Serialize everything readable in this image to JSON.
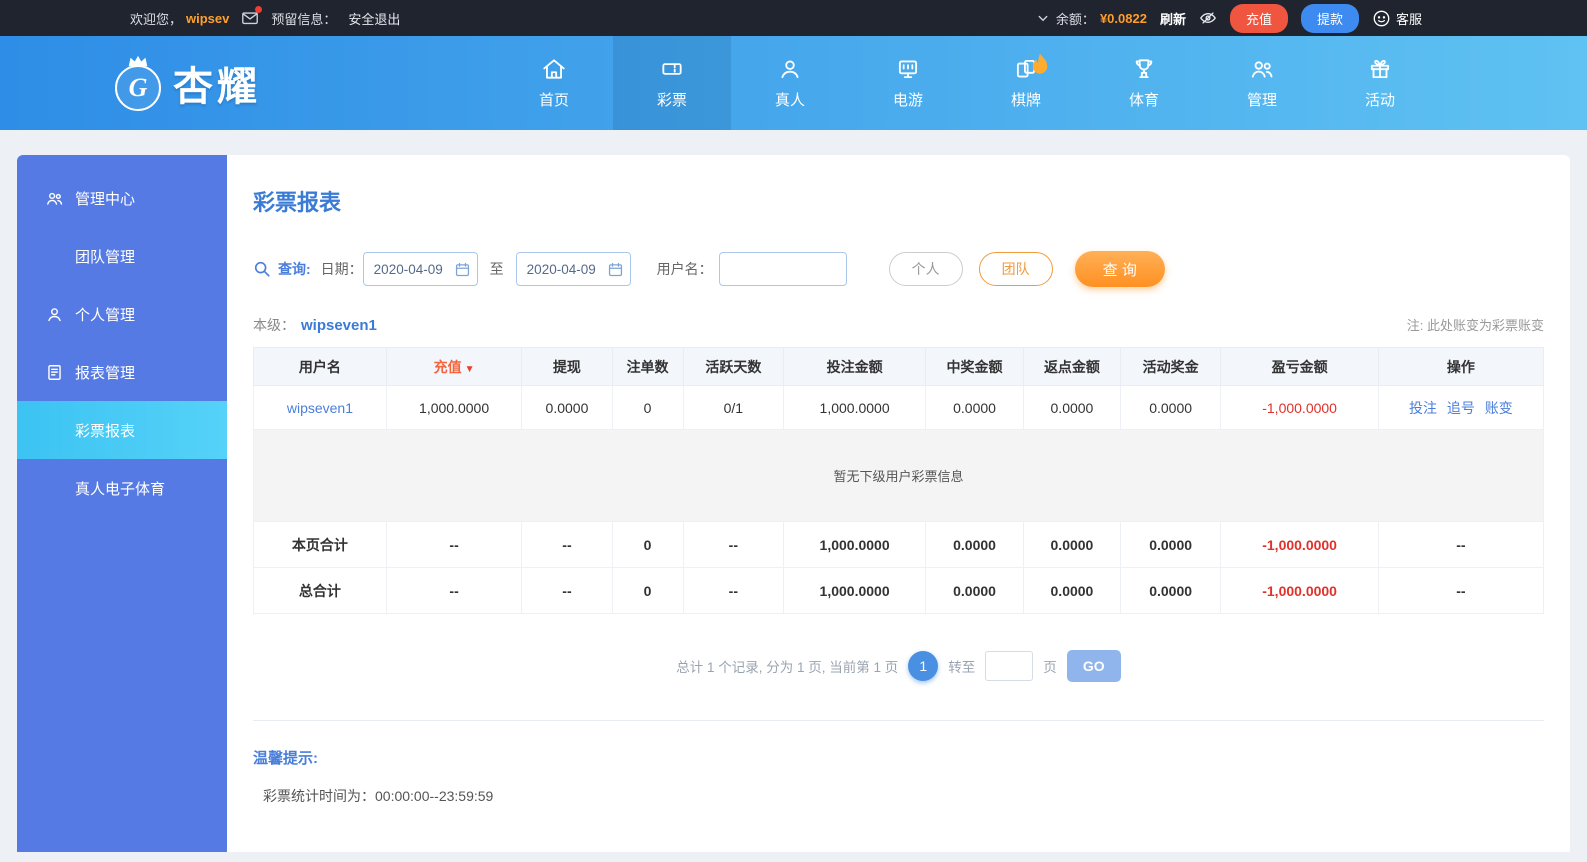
{
  "topbar": {
    "welcome_prefix": "欢迎您，",
    "username": "wipsev",
    "reserved_label": "预留信息：",
    "logout_label": "安全退出",
    "balance_label": "余额：",
    "balance_value": "¥0.0822",
    "refresh_label": "刷新",
    "recharge_label": "充值",
    "withdraw_label": "提款",
    "service_label": "客服"
  },
  "nav": {
    "brand": "杏耀",
    "items": [
      {
        "label": "首页"
      },
      {
        "label": "彩票"
      },
      {
        "label": "真人"
      },
      {
        "label": "电游"
      },
      {
        "label": "棋牌"
      },
      {
        "label": "体育"
      },
      {
        "label": "管理"
      },
      {
        "label": "活动"
      }
    ]
  },
  "sidebar": {
    "items": [
      {
        "label": "管理中心"
      },
      {
        "label": "团队管理"
      },
      {
        "label": "个人管理"
      },
      {
        "label": "报表管理"
      },
      {
        "label": "彩票报表"
      },
      {
        "label": "真人电子体育"
      }
    ]
  },
  "main": {
    "title": "彩票报表",
    "search": {
      "query_label": "查询:",
      "date_label": "日期：",
      "date_from": "2020-04-09",
      "to_label": "至",
      "date_to": "2020-04-09",
      "username_label": "用户名：",
      "personal_button": "个人",
      "team_button": "团队",
      "search_button": "查 询"
    },
    "level_label": "本级：",
    "level_user": "wipseven1",
    "note": "注: 此处账变为彩票账变",
    "table": {
      "headers": [
        "用户名",
        "充值",
        "提现",
        "注单数",
        "活跃天数",
        "投注金额",
        "中奖金额",
        "返点金额",
        "活动奖金",
        "盈亏金额",
        "操作"
      ],
      "sort_arrow": "▼",
      "rows": [
        {
          "username": "wipseven1",
          "recharge": "1,000.0000",
          "withdraw": "0.0000",
          "bet_count": "0",
          "active_days": "0/1",
          "bet_amount": "1,000.0000",
          "win_amount": "0.0000",
          "rebate_amount": "0.0000",
          "activity_bonus": "0.0000",
          "profit_loss": "-1,000.0000",
          "actions": [
            "投注",
            "追号",
            "账变"
          ]
        }
      ],
      "empty_message": "暂无下级用户彩票信息",
      "page_total": {
        "label": "本页合计",
        "recharge": "--",
        "withdraw": "--",
        "bet_count": "0",
        "active_days": "--",
        "bet_amount": "1,000.0000",
        "win_amount": "0.0000",
        "rebate_amount": "0.0000",
        "activity_bonus": "0.0000",
        "profit_loss": "-1,000.0000",
        "actions": "--"
      },
      "grand_total": {
        "label": "总合计",
        "recharge": "--",
        "withdraw": "--",
        "bet_count": "0",
        "active_days": "--",
        "bet_amount": "1,000.0000",
        "win_amount": "0.0000",
        "rebate_amount": "0.0000",
        "activity_bonus": "0.0000",
        "profit_loss": "-1,000.0000",
        "actions": "--"
      }
    },
    "pagination": {
      "summary": "总计 1 个记录, 分为 1 页, 当前第 1 页",
      "current_page": "1",
      "goto_label": "转至",
      "page_unit": "页",
      "go_button": "GO"
    },
    "tips": {
      "title": "温馨提示:",
      "content": "彩票统计时间为：00:00:00--23:59:59"
    }
  },
  "icons": {
    "envelope-icon": "✉",
    "caret-down-icon": "∨",
    "eye-slash-icon": "visibility-toggle",
    "service-icon": "smiley-bubble",
    "search-icon": "magnifier",
    "calendar-icon": "calendar",
    "flame-icon": "hot-flame"
  },
  "colors": {
    "accent_orange": "#ff9d2b",
    "negative_red": "#e0312a",
    "link_blue": "#4a7edb",
    "nav_blue": "#2e8de6",
    "sidebar_blue": "#567ae4",
    "active_cyan": "#3cc3f2"
  }
}
